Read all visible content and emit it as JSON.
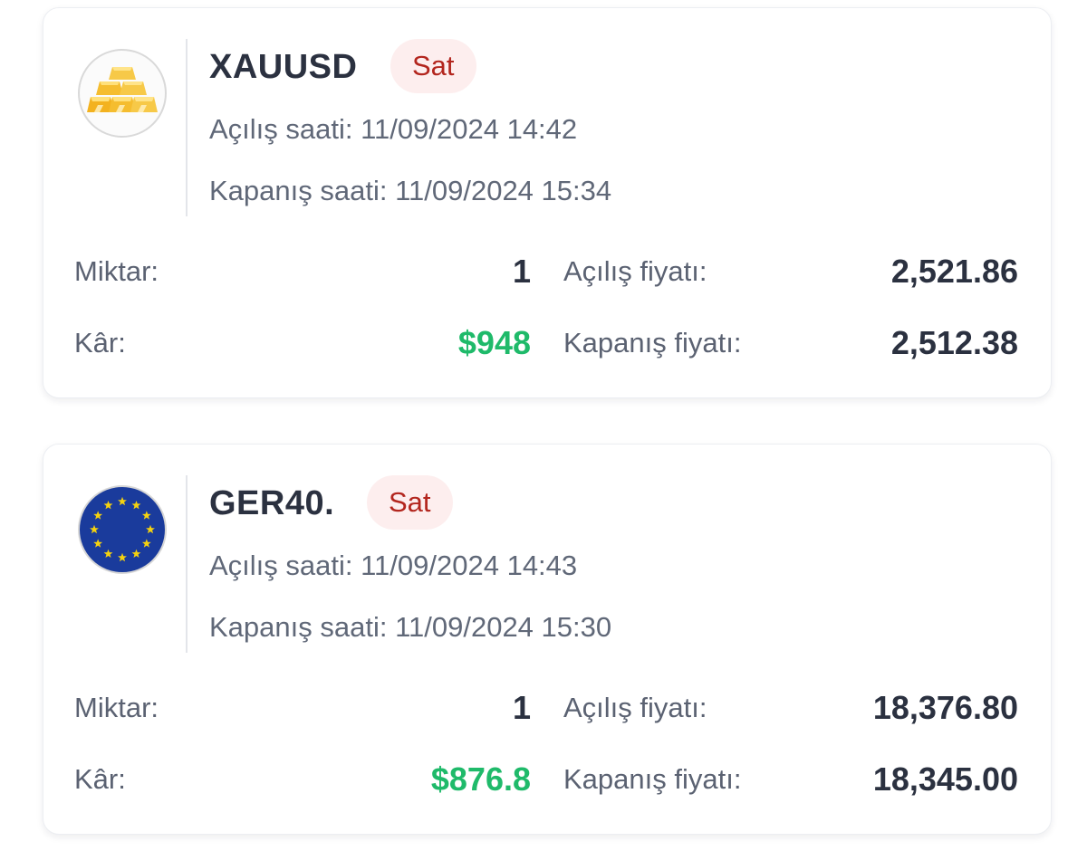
{
  "colors": {
    "badge_bg": "#fdeeee",
    "badge_text": "#b3261e",
    "profit": "#1fba6a",
    "primary_text": "#2b3140",
    "secondary_text": "#606878"
  },
  "trades": [
    {
      "icon": "gold-bars-icon",
      "symbol": "XAUUSD",
      "side": "Sat",
      "open_time": "Açılış saati: 11/09/2024 14:42",
      "close_time": "Kapanış saati: 11/09/2024 15:34",
      "quantity_label": "Miktar:",
      "quantity": "1",
      "profit_label": "Kâr:",
      "profit": "$948",
      "open_price_label": "Açılış fiyatı:",
      "open_price": "2,521.86",
      "close_price_label": "Kapanış fiyatı:",
      "close_price": "2,512.38"
    },
    {
      "icon": "eu-flag-icon",
      "symbol": "GER40.",
      "side": "Sat",
      "open_time": "Açılış saati: 11/09/2024 14:43",
      "close_time": "Kapanış saati: 11/09/2024 15:30",
      "quantity_label": "Miktar:",
      "quantity": "1",
      "profit_label": "Kâr:",
      "profit": "$876.8",
      "open_price_label": "Açılış fiyatı:",
      "open_price": "18,376.80",
      "close_price_label": "Kapanış fiyatı:",
      "close_price": "18,345.00"
    }
  ]
}
